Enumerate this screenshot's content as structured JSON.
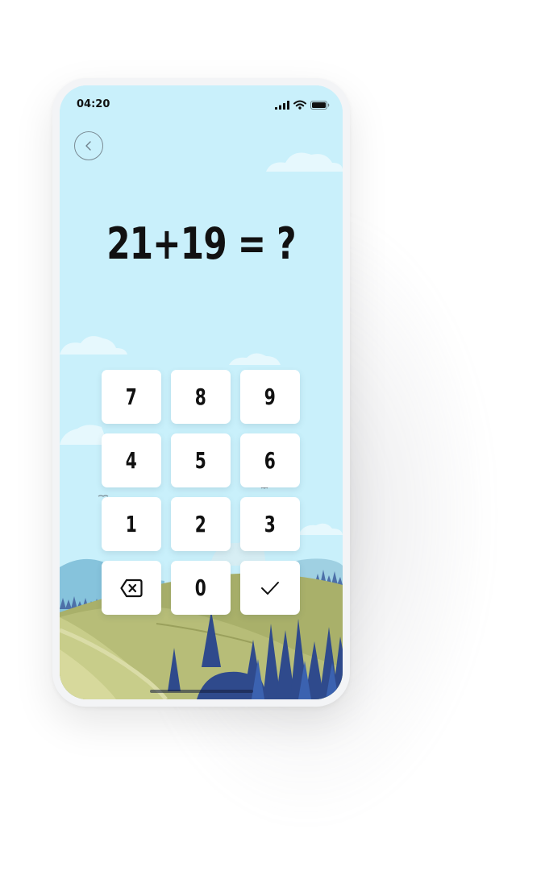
{
  "status_bar": {
    "time": "04:20",
    "icons": [
      "cellular-signal-icon",
      "wifi-icon",
      "battery-icon"
    ]
  },
  "navigation": {
    "back_icon": "chevron-left-icon"
  },
  "question": {
    "text": "21+19 = ?"
  },
  "keypad": {
    "keys": [
      {
        "label": "7"
      },
      {
        "label": "8"
      },
      {
        "label": "9"
      },
      {
        "label": "4"
      },
      {
        "label": "5"
      },
      {
        "label": "6"
      },
      {
        "label": "1"
      },
      {
        "label": "2"
      },
      {
        "label": "3"
      },
      {
        "icon": "backspace-icon"
      },
      {
        "label": "0"
      },
      {
        "icon": "checkmark-icon"
      }
    ]
  },
  "colors": {
    "sky": "#c9f0fb",
    "key_background": "#ffffff",
    "text": "#111111",
    "hill_green": "#b4b774",
    "trees_blue": "#2f4a8c",
    "mountains_blue": "#7fbfd9"
  }
}
